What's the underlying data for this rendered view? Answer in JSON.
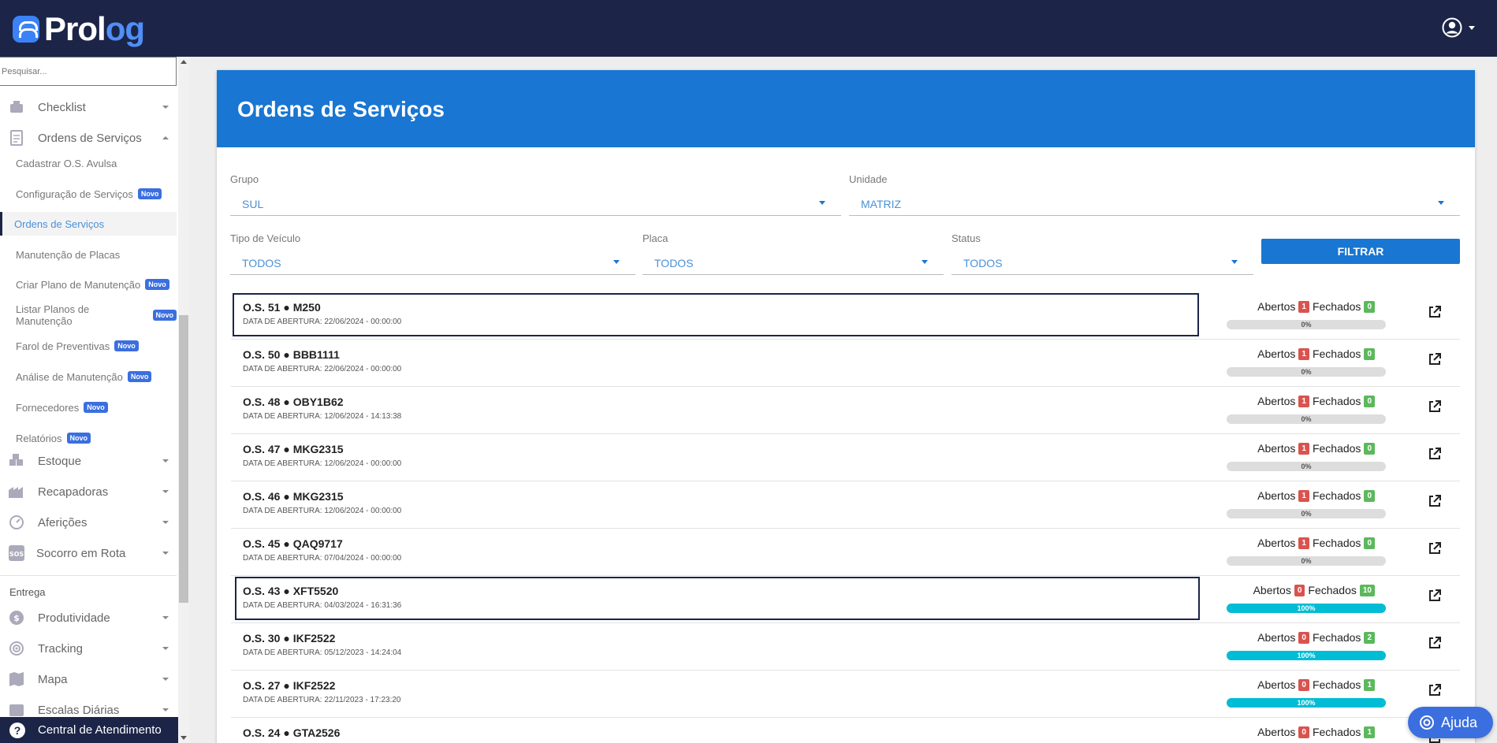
{
  "brand": {
    "name_part1": "Pr",
    "name_part2": "ol",
    "name_part3": "og"
  },
  "sidebar": {
    "search_placeholder": "Pesquisar...",
    "checklist": "Checklist",
    "ordens_servicos": "Ordens de Serviços",
    "subitems": [
      {
        "label": "Cadastrar O.S. Avulsa",
        "novo": false
      },
      {
        "label": "Configuração de Serviços",
        "novo": true
      },
      {
        "label": "Ordens de Serviços",
        "novo": false,
        "active": true
      },
      {
        "label": "Manutenção de Placas",
        "novo": false
      },
      {
        "label": "Criar Plano de Manutenção",
        "novo": true
      },
      {
        "label": "Listar Planos de Manutenção",
        "novo": true
      },
      {
        "label": "Farol de Preventivas",
        "novo": true
      },
      {
        "label": "Análise de Manutenção",
        "novo": true
      },
      {
        "label": "Fornecedores",
        "novo": true
      },
      {
        "label": "Relatórios",
        "novo": true
      }
    ],
    "novo_label": "Novo",
    "estoque": "Estoque",
    "recapadoras": "Recapadoras",
    "afericoes": "Aferições",
    "socorro": "Socorro em Rota",
    "entrega_section": "Entrega",
    "produtividade": "Produtividade",
    "tracking": "Tracking",
    "mapa": "Mapa",
    "escalas": "Escalas Diárias",
    "central": "Central de Atendimento"
  },
  "page": {
    "title": "Ordens de Serviços"
  },
  "filters": {
    "grupo": {
      "label": "Grupo",
      "value": "SUL"
    },
    "unidade": {
      "label": "Unidade",
      "value": "MATRIZ"
    },
    "tipo": {
      "label": "Tipo de Veículo",
      "value": "TODOS"
    },
    "placa": {
      "label": "Placa",
      "value": "TODOS"
    },
    "status": {
      "label": "Status",
      "value": "TODOS"
    },
    "button": "FILTRAR"
  },
  "labels": {
    "abertos": "Abertos",
    "fechados": "Fechados"
  },
  "orders": [
    {
      "title": "O.S. 51 ● M250",
      "date": "DATA DE ABERTURA: 22/06/2024 - 00:00:00",
      "abertos": "1",
      "fechados": "0",
      "progress": "0%",
      "highlight": "wide"
    },
    {
      "title": "O.S. 50 ● BBB1111",
      "date": "DATA DE ABERTURA: 22/06/2024 - 00:00:00",
      "abertos": "1",
      "fechados": "0",
      "progress": "0%"
    },
    {
      "title": "O.S. 48 ● OBY1B62",
      "date": "DATA DE ABERTURA: 12/06/2024 - 14:13:38",
      "abertos": "1",
      "fechados": "0",
      "progress": "0%"
    },
    {
      "title": "O.S. 47 ● MKG2315",
      "date": "DATA DE ABERTURA: 12/06/2024 - 00:00:00",
      "abertos": "1",
      "fechados": "0",
      "progress": "0%"
    },
    {
      "title": "O.S. 46 ● MKG2315",
      "date": "DATA DE ABERTURA: 12/06/2024 - 00:00:00",
      "abertos": "1",
      "fechados": "0",
      "progress": "0%"
    },
    {
      "title": "O.S. 45 ● QAQ9717",
      "date": "DATA DE ABERTURA: 07/04/2024 - 00:00:00",
      "abertos": "1",
      "fechados": "0",
      "progress": "0%"
    },
    {
      "title": "O.S. 43 ● XFT5520",
      "date": "DATA DE ABERTURA: 04/03/2024 - 16:31:36",
      "abertos": "0",
      "fechados": "10",
      "progress": "100%",
      "highlight": "narrow"
    },
    {
      "title": "O.S. 30 ● IKF2522",
      "date": "DATA DE ABERTURA: 05/12/2023 - 14:24:04",
      "abertos": "0",
      "fechados": "2",
      "progress": "100%"
    },
    {
      "title": "O.S. 27 ● IKF2522",
      "date": "DATA DE ABERTURA: 22/11/2023 - 17:23:20",
      "abertos": "0",
      "fechados": "1",
      "progress": "100%"
    },
    {
      "title": "O.S. 24 ● GTA2526",
      "date": "",
      "abertos": "0",
      "fechados": "1",
      "progress": ""
    }
  ],
  "help": {
    "label": "Ajuda"
  }
}
